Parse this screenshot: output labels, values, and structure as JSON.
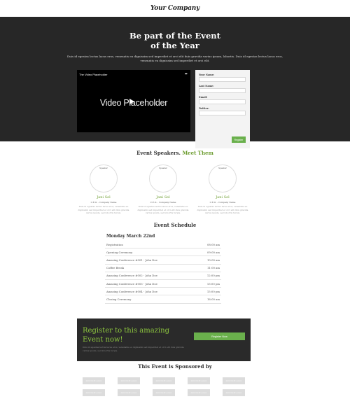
{
  "header": {
    "logo": "Your Company"
  },
  "hero": {
    "title_line1": "Be part of the Event",
    "title_line2": "of the Year",
    "subtitle": "Duis id egestas lectus lacus eros, venenatis eu dignissim sed imperdiet et orci elit duis gravida varius ipsum, lobortis. Duis id egestas lectus lacus eros, venenatis eu dignissim sed imperdiet et orci elit."
  },
  "video": {
    "title": "The Video Placeholder",
    "share_icon": "share-icon",
    "placeholder_text": "Video Placeholder",
    "play_icon": "play-icon"
  },
  "form": {
    "fields": [
      {
        "label": "Your Name:",
        "value": ""
      },
      {
        "label": "Last Name:",
        "value": ""
      },
      {
        "label": "Email:",
        "value": ""
      },
      {
        "label": "Twitter:",
        "value": ""
      }
    ],
    "submit_label": "Register"
  },
  "speakers": {
    "heading": "Event Speakers.",
    "heading_accent": "Meet Them",
    "items": [
      {
        "image_label": "Speaker",
        "name": "Jani Sel",
        "role": "C.E.O. - Company Name",
        "bio": "Duis id egestas lectus lacus eros, venenatis eu dignissim sed imperdiet et orci elit duis gravida varius ipsum, sed lobortis turpis."
      },
      {
        "image_label": "Speaker",
        "name": "Jani Sel",
        "role": "C.E.O. - Company Name",
        "bio": "Duis id egestas lectus lacus eros, venenatis eu dignissim sed imperdiet et orci elit duis gravida varius ipsum, sed lobortis turpis."
      },
      {
        "image_label": "Speaker",
        "name": "Jani Sel",
        "role": "C.E.O. - Company Name",
        "bio": "Duis id egestas lectus lacus eros, venenatis eu dignissim sed imperdiet et orci elit duis gravida varius ipsum, sed lobortis turpis."
      }
    ]
  },
  "schedule": {
    "heading": "Event Schedule",
    "day": "Monday March 22nd",
    "rows": [
      {
        "event": "Registration",
        "time": "08:00 am"
      },
      {
        "event": "Opening Ceremony",
        "time": "09:00 am"
      },
      {
        "event": "Amazing Conference #001 - John Doe",
        "time": "10:00 am"
      },
      {
        "event": "Coffee Break",
        "time": "11:00 am"
      },
      {
        "event": "Amazing Conference #002 - John Doe",
        "time": "12:00 pm"
      },
      {
        "event": "Amazing Conference #003 - John Doe",
        "time": "13:00 pm"
      },
      {
        "event": "Amazing Conference #004 - John Doe",
        "time": "15:00 pm"
      },
      {
        "event": "Closing Ceremony",
        "time": "16:00 am"
      }
    ]
  },
  "register": {
    "title": "Register to this amazing Event now!",
    "text": "Duis id egestas lectus lacus eros, venenatis eu dignissim sed imperdiet et orci elit duis gravida varius ipsum, sed lobortis turpis.",
    "button_label": "Register Now"
  },
  "sponsors": {
    "heading": "This Event is Sponsored by",
    "logos": [
      "SPONSOR LOGO",
      "SPONSOR LOGO",
      "SPONSOR LOGO",
      "SPONSOR LOGO",
      "SPONSOR LOGO",
      "SPONSOR LOGO",
      "SPONSOR LOGO",
      "SPONSOR LOGO",
      "SPONSOR LOGO",
      "SPONSOR LOGO"
    ]
  },
  "colors": {
    "accent": "#6c9c2f",
    "button": "#6ab04c",
    "dark": "#272727"
  }
}
